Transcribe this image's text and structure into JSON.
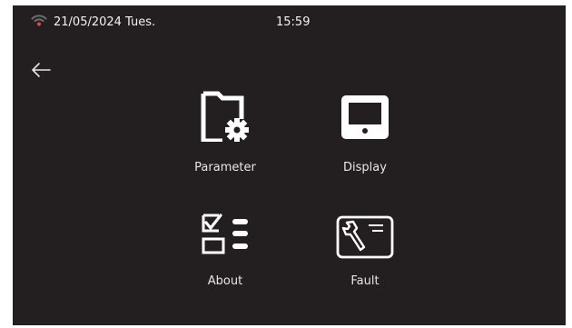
{
  "status_bar": {
    "date": "21/05/2024 Tues.",
    "time": "15:59",
    "wifi_icon": "wifi-signal-icon",
    "wifi_color": "#e8483a"
  },
  "navigation": {
    "back_icon": "back-arrow-icon"
  },
  "menu": [
    {
      "label": "Parameter",
      "icon": "folder-gear-icon"
    },
    {
      "label": "Display",
      "icon": "monitor-icon"
    },
    {
      "label": "About",
      "icon": "checklist-icon"
    },
    {
      "label": "Fault",
      "icon": "wrench-sheet-icon"
    }
  ],
  "colors": {
    "background": "#231f20",
    "foreground": "#ffffff"
  }
}
